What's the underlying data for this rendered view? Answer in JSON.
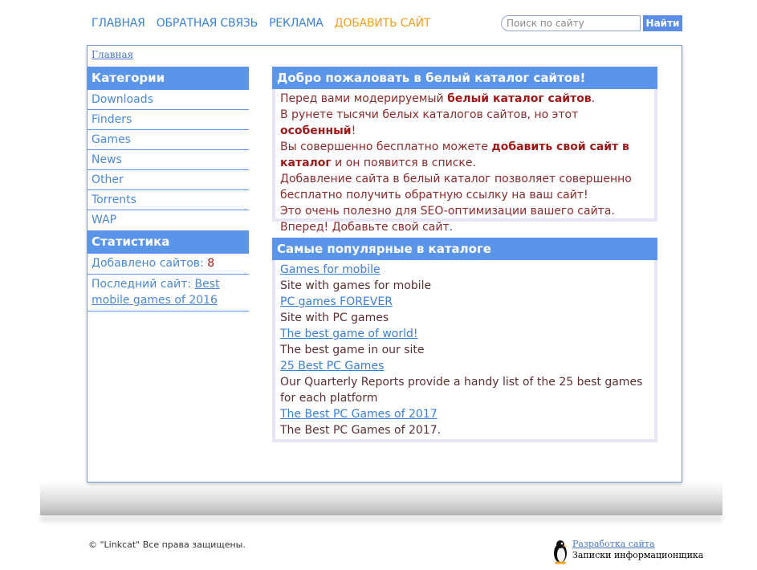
{
  "nav": {
    "items": [
      {
        "label": "ГЛАВНАЯ"
      },
      {
        "label": "ОБРАТНАЯ СВЯЗЬ"
      },
      {
        "label": "РЕКЛАМА"
      },
      {
        "label": "ДОБАВИТЬ САЙТ"
      }
    ]
  },
  "search": {
    "placeholder": "Поиск по сайту",
    "button_label": "Найти"
  },
  "breadcrumb": "Главная",
  "sidebar": {
    "categories_title": "Категории",
    "categories": [
      {
        "label": "Downloads"
      },
      {
        "label": "Finders"
      },
      {
        "label": "Games"
      },
      {
        "label": "News"
      },
      {
        "label": "Other"
      },
      {
        "label": "Torrents"
      },
      {
        "label": "WAP"
      }
    ],
    "stats_title": "Статистика",
    "added_label": "Добавлено сайтов: ",
    "added_count": "8",
    "last_label": "Последний сайт: ",
    "last_site": "Best mobile games of 2016"
  },
  "welcome": {
    "title": "Добро пожаловать в белый каталог сайтов!",
    "l1a": "Перед вами модерируемый ",
    "l1b": "белый каталог сайтов",
    "l1c": ".",
    "l2a": "В рунете тысячи белых каталогов сайтов, но этот ",
    "l2b": "особенный",
    "l2c": "!",
    "l3a": "Вы совершенно бесплатно можете ",
    "l3b": "добавить свой сайт в каталог",
    "l3c": " и он появится в списке.",
    "l4": "Добавление сайта в белый каталог позволяет совершенно бесплатно получить обратную ссылку на ваш сайт!",
    "l5": "Это очень полезно для SEO-оптимизации вашего сайта.",
    "l6": "Вперед! Добавьте свой сайт."
  },
  "popular": {
    "title": "Самые популярные в каталоге",
    "items": [
      {
        "name": "Games for mobile",
        "desc": "Site with games for mobile"
      },
      {
        "name": "PC games FOREVER",
        "desc": "Site with PC games"
      },
      {
        "name": "The best game of world!",
        "desc": "The best game in our site"
      },
      {
        "name": "25 Best PC Games",
        "desc": "Our Quarterly Reports provide a handy list of the 25 best games for each platform"
      },
      {
        "name": "The Best PC Games of 2017",
        "desc": "The Best PC Games of 2017."
      }
    ]
  },
  "footer": {
    "copyright": "© \"Linkcat\" Все права защищены.",
    "credit_link": "Разработка сайта",
    "credit_sub": "Записки информационщика"
  },
  "colors": {
    "accent": "#5b95ea",
    "nav_link": "#3a7fd6",
    "nav_highlight": "#f0a020",
    "text_dark_red": "#a01818"
  }
}
